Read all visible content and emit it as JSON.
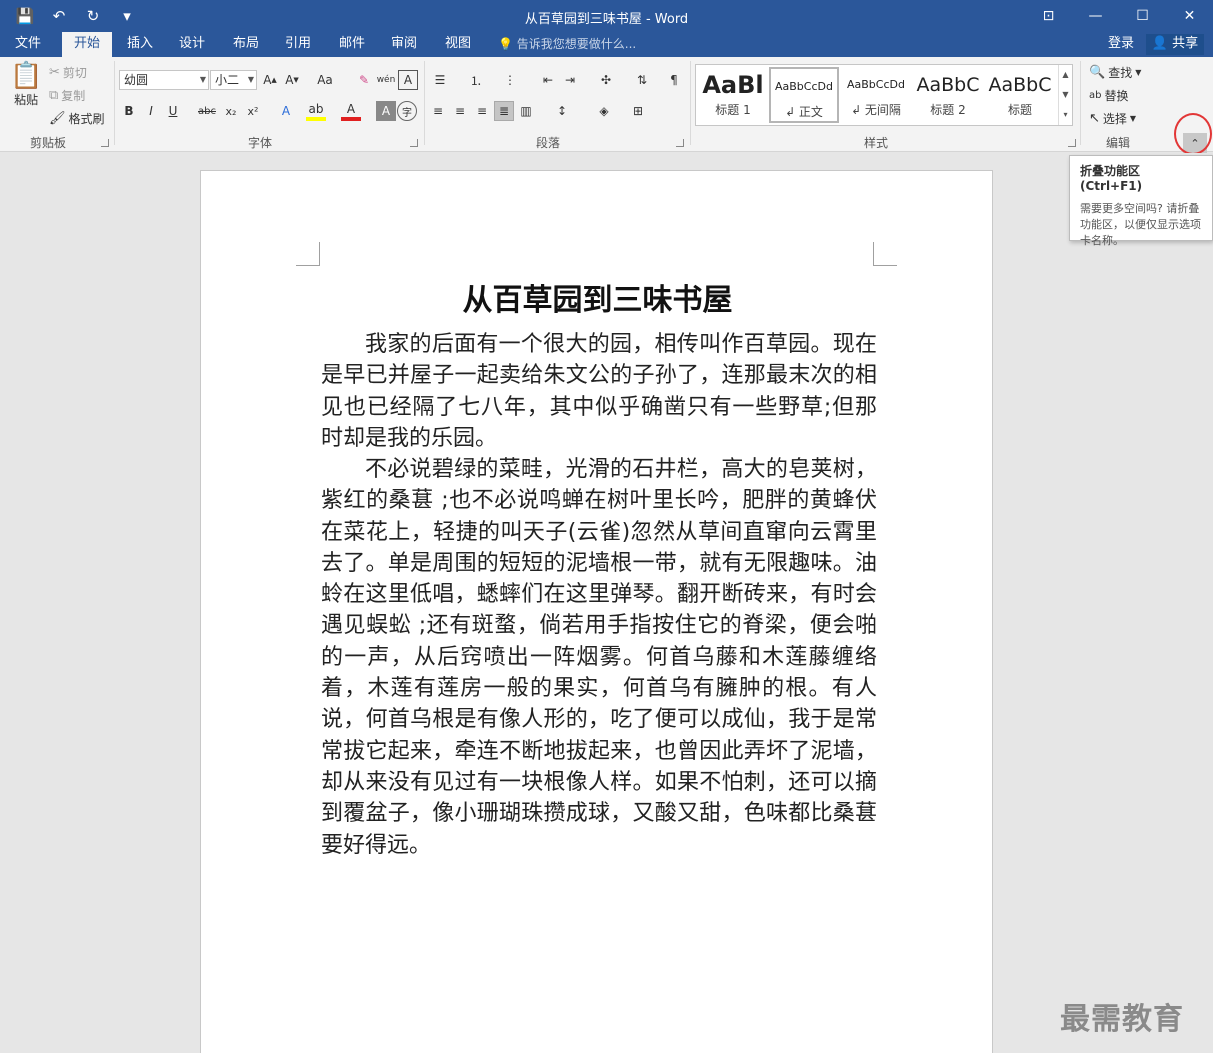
{
  "window": {
    "title": "从百草园到三味书屋 - Word",
    "qat": {
      "save_icon": "💾",
      "undo_icon": "↶",
      "redo_icon": "↻",
      "more_icon": "▾"
    },
    "controls": {
      "ribbon_options_icon": "⊡",
      "minimize_icon": "—",
      "maximize_icon": "☐",
      "close_icon": "✕"
    }
  },
  "tabs": [
    {
      "label": "文件"
    },
    {
      "label": "开始"
    },
    {
      "label": "插入"
    },
    {
      "label": "设计"
    },
    {
      "label": "布局"
    },
    {
      "label": "引用"
    },
    {
      "label": "邮件"
    },
    {
      "label": "审阅"
    },
    {
      "label": "视图"
    }
  ],
  "tell_me": "告诉我您想要做什么...",
  "account": {
    "login": "登录",
    "share": "共享"
  },
  "clipboard": {
    "paste": "粘贴",
    "cut": "剪切",
    "copy": "复制",
    "format_painter": "格式刷",
    "group": "剪贴板"
  },
  "font": {
    "family": "幼圆",
    "size": "小二",
    "change_case": "Aa",
    "group": "字体"
  },
  "paragraph": {
    "group": "段落"
  },
  "styles": {
    "group": "样式",
    "items": [
      {
        "preview": "AaBl",
        "name": "标题 1"
      },
      {
        "preview": "AaBbCcDd",
        "name": "↲ 正文"
      },
      {
        "preview": "AaBbCcDd",
        "name": "↲ 无间隔"
      },
      {
        "preview": "AaBbC",
        "name": "标题 2"
      },
      {
        "preview": "AaBbC",
        "name": "标题"
      }
    ]
  },
  "editing": {
    "find": "查找",
    "replace": "替换",
    "select": "选择",
    "group": "编辑"
  },
  "tooltip": {
    "title": "折叠功能区(Ctrl+F1)",
    "body": "需要更多空间吗? 请折叠功能区，以便仅显示选项卡名称。"
  },
  "document": {
    "title": "从百草园到三味书屋",
    "paragraphs": [
      "我家的后面有一个很大的园，相传叫作百草园。现在是早已并屋子一起卖给朱文公的子孙了，连那最末次的相见也已经隔了七八年，其中似乎确凿只有一些野草;但那时却是我的乐园。",
      "不必说碧绿的菜畦，光滑的石井栏，高大的皂荚树，紫红的桑葚 ;也不必说鸣蝉在树叶里长吟，肥胖的黄蜂伏在菜花上，轻捷的叫天子(云雀)忽然从草间直窜向云霄里去了。单是周围的短短的泥墙根一带，就有无限趣味。油蛉在这里低唱，蟋蟀们在这里弹琴。翻开断砖来，有时会遇见蜈蚣 ;还有斑蝥，倘若用手指按住它的脊梁，便会啪的一声，从后窍喷出一阵烟雾。何首乌藤和木莲藤缠络着，木莲有莲房一般的果实，何首乌有臃肿的根。有人说，何首乌根是有像人形的，吃了便可以成仙，我于是常常拔它起来，牵连不断地拔起来，也曾因此弄坏了泥墙，却从来没有见过有一块根像人样。如果不怕刺，还可以摘到覆盆子，像小珊瑚珠攒成球，又酸又甜，色味都比桑葚要好得远。"
    ]
  },
  "watermark": "最需教育"
}
